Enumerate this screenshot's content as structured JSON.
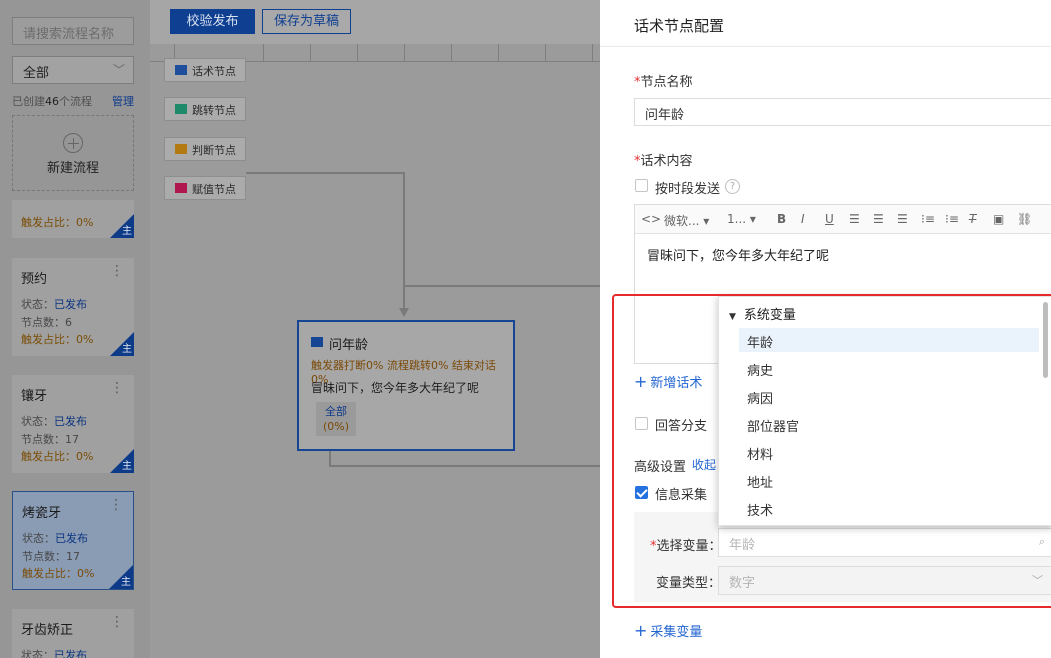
{
  "sidebar": {
    "search_placeholder": "请搜索流程名称",
    "filter_value": "全部",
    "count_prefix": "已创建",
    "count_number": "46",
    "count_suffix": "个流程",
    "manage_label": "管理",
    "new_flow_label": "新建流程",
    "corner_label": "主",
    "status_label": "状态：",
    "nodes_label": "节点数：",
    "trigger_label": "触发占比：",
    "cards": [
      {
        "name": "",
        "status": "",
        "nodes": "",
        "trigger": "0%"
      },
      {
        "name": "预约",
        "status": "已发布",
        "nodes": "6",
        "trigger": "0%"
      },
      {
        "name": "镶牙",
        "status": "已发布",
        "nodes": "17",
        "trigger": "0%"
      },
      {
        "name": "烤瓷牙",
        "status": "已发布",
        "nodes": "17",
        "trigger": "0%"
      },
      {
        "name": "牙齿矫正",
        "status": "已发布",
        "nodes": "",
        "trigger": ""
      }
    ]
  },
  "toolbar": {
    "validate_publish": "校验发布",
    "save_draft": "保存为草稿"
  },
  "node_types": [
    {
      "label": "话术节点",
      "icon": "speech-node-icon",
      "color": "#1f4f9c"
    },
    {
      "label": "跳转节点",
      "icon": "jump-node-icon",
      "color": "#1e8a6a"
    },
    {
      "label": "判断节点",
      "icon": "decision-node-icon",
      "color": "#b27a10"
    },
    {
      "label": "赋值节点",
      "icon": "assign-node-icon",
      "color": "#b0174f"
    }
  ],
  "flow_node": {
    "title": "问年龄",
    "stats": "触发器打断0% 流程跳转0% 结束对话0%",
    "content": "冒昧问下，您今年多大年纪了呢",
    "branch_label": "全部",
    "branch_pct": "(0%)"
  },
  "panel": {
    "title": "话术节点配置",
    "node_name_label": "节点名称",
    "node_name_value": "问年龄",
    "content_label": "话术内容",
    "timed_send_label": "按时段发送",
    "editor_font": "微软...",
    "editor_size": "1...",
    "editor_text": "冒昧问下，您今年多大年纪了呢",
    "add_speech": "新增话术",
    "answer_branch": "回答分支",
    "advanced_label": "高级设置",
    "collapse_label": "收起",
    "info_collect": "信息采集",
    "select_var_label": "选择变量：",
    "select_var_value": "年龄",
    "var_type_label": "变量类型：",
    "var_type_value": "数字",
    "collect_var": "采集变量"
  },
  "dropdown": {
    "group": "系统变量",
    "items": [
      "年龄",
      "病史",
      "病因",
      "部位器官",
      "材料",
      "地址",
      "技术"
    ],
    "active_index": 0
  },
  "colors": {
    "primary": "#2366d1",
    "highlight_border": "#e62a2a",
    "required": "#e0312f"
  }
}
